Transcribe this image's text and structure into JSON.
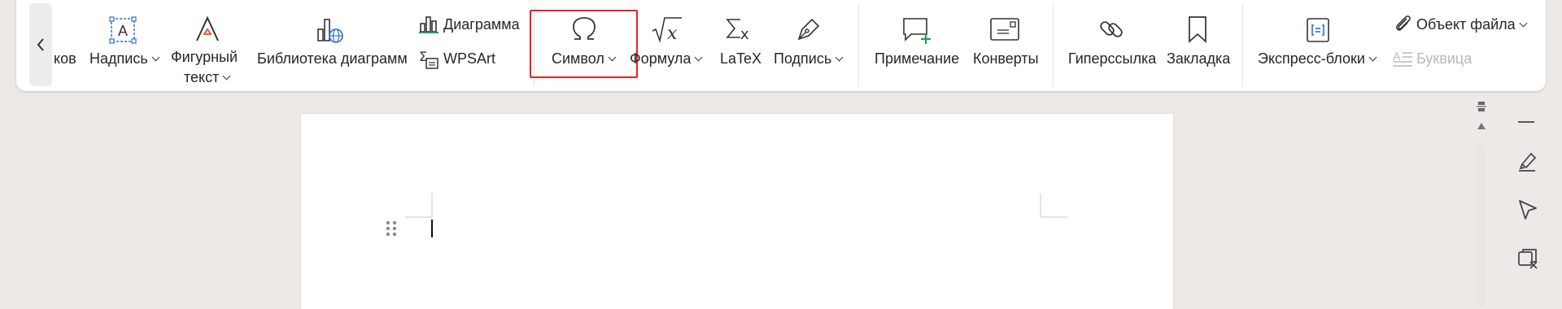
{
  "ribbon": {
    "truncated_left_label": "ков",
    "items": {
      "inscription": "Надпись",
      "shape_text_line1": "Фигурный",
      "shape_text_line2": "текст",
      "chart_library": "Библиотека диаграмм",
      "chart": "Диаграмма",
      "wpsart": "WPSArt",
      "symbol": "Символ",
      "formula": "Формула",
      "latex": "LaTeX",
      "signature": "Подпись",
      "comment": "Примечание",
      "envelopes": "Конверты",
      "hyperlink": "Гиперссылка",
      "bookmark": "Закладка",
      "quick_parts": "Экспресс-блоки",
      "file_object": "Объект файла",
      "drop_cap": "Буквица"
    },
    "highlight_color": "#e8202a",
    "accent_green": "#1e9e4a",
    "accent_blue": "#2c6fd6"
  },
  "icons": {
    "scroll_left": "chevron-left-icon",
    "inscription": "text-box-icon",
    "shape_text": "shape-text-icon",
    "chart_library": "chart-library-icon",
    "chart": "chart-icon",
    "wpsart": "wpsart-icon",
    "symbol": "omega-icon",
    "formula": "sqrt-x-icon",
    "latex": "sigma-x-icon",
    "signature": "pen-nib-icon",
    "comment": "comment-add-icon",
    "envelopes": "envelope-icon",
    "hyperlink": "link-icon",
    "bookmark": "bookmark-icon",
    "quick_parts": "quick-parts-icon",
    "file_object": "paperclip-icon",
    "drop_cap": "drop-cap-icon",
    "side_minimize": "minus-icon",
    "side_highlighter": "highlighter-icon",
    "side_select": "cursor-arrow-icon",
    "side_clear": "clear-format-icon"
  }
}
